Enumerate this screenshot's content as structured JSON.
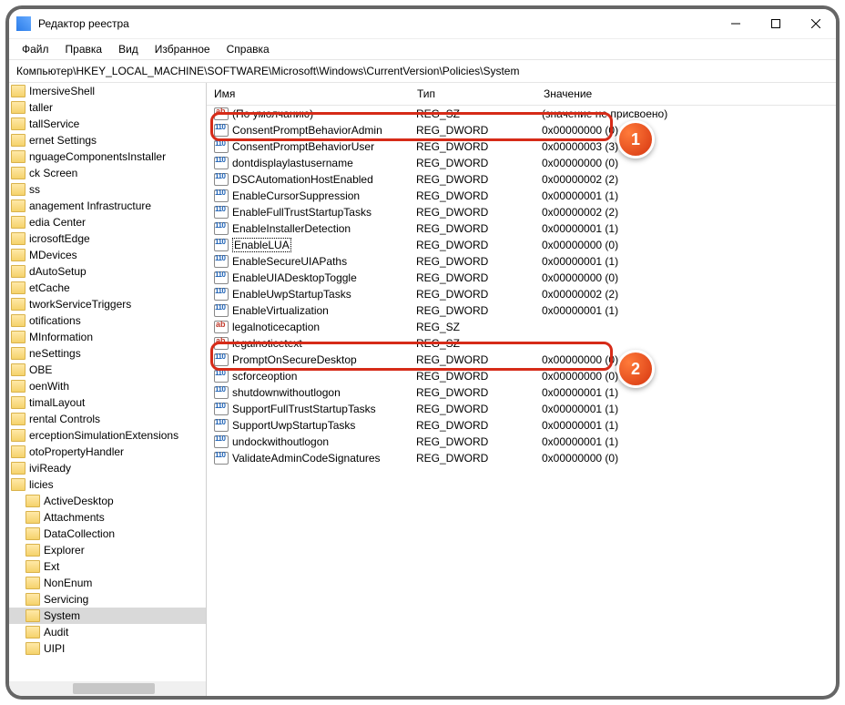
{
  "titlebar": {
    "title": "Редактор реестра"
  },
  "menu": {
    "file": "Файл",
    "edit": "Правка",
    "view": "Вид",
    "favorites": "Избранное",
    "help": "Справка"
  },
  "address": "Компьютер\\HKEY_LOCAL_MACHINE\\SOFTWARE\\Microsoft\\Windows\\CurrentVersion\\Policies\\System",
  "tree": [
    {
      "label": "ImersiveShell"
    },
    {
      "label": "taller"
    },
    {
      "label": "tallService"
    },
    {
      "label": "ernet Settings"
    },
    {
      "label": "nguageComponentsInstaller"
    },
    {
      "label": "ck Screen"
    },
    {
      "label": "ss"
    },
    {
      "label": "anagement Infrastructure"
    },
    {
      "label": "edia Center"
    },
    {
      "label": "icrosoftEdge"
    },
    {
      "label": "MDevices"
    },
    {
      "label": "dAutoSetup"
    },
    {
      "label": "etCache"
    },
    {
      "label": "tworkServiceTriggers"
    },
    {
      "label": "otifications"
    },
    {
      "label": "MInformation"
    },
    {
      "label": "neSettings"
    },
    {
      "label": "OBE"
    },
    {
      "label": "oenWith"
    },
    {
      "label": "timalLayout"
    },
    {
      "label": "rental Controls"
    },
    {
      "label": "erceptionSimulationExtensions"
    },
    {
      "label": "otoPropertyHandler"
    },
    {
      "label": "iviReady"
    },
    {
      "label": "licies"
    },
    {
      "label": "ActiveDesktop",
      "indent": 1
    },
    {
      "label": "Attachments",
      "indent": 1
    },
    {
      "label": "DataCollection",
      "indent": 1
    },
    {
      "label": "Explorer",
      "indent": 1
    },
    {
      "label": "Ext",
      "indent": 1
    },
    {
      "label": "NonEnum",
      "indent": 1
    },
    {
      "label": "Servicing",
      "indent": 1
    },
    {
      "label": "System",
      "indent": 1,
      "selected": true
    },
    {
      "label": "Audit",
      "indent": 1
    },
    {
      "label": "UIPI",
      "indent": 1
    }
  ],
  "list_header": {
    "name": "Имя",
    "type": "Тип",
    "value": "Значение"
  },
  "rows": [
    {
      "icon": "sz",
      "name": "(По умолчанию)",
      "type": "REG_SZ",
      "value": "(значение не присвоено)"
    },
    {
      "icon": "dw",
      "name": "ConsentPromptBehaviorAdmin",
      "type": "REG_DWORD",
      "value": "0x00000000 (0)"
    },
    {
      "icon": "dw",
      "name": "ConsentPromptBehaviorUser",
      "type": "REG_DWORD",
      "value": "0x00000003 (3)"
    },
    {
      "icon": "dw",
      "name": "dontdisplaylastusername",
      "type": "REG_DWORD",
      "value": "0x00000000 (0)"
    },
    {
      "icon": "dw",
      "name": "DSCAutomationHostEnabled",
      "type": "REG_DWORD",
      "value": "0x00000002 (2)"
    },
    {
      "icon": "dw",
      "name": "EnableCursorSuppression",
      "type": "REG_DWORD",
      "value": "0x00000001 (1)"
    },
    {
      "icon": "dw",
      "name": "EnableFullTrustStartupTasks",
      "type": "REG_DWORD",
      "value": "0x00000002 (2)"
    },
    {
      "icon": "dw",
      "name": "EnableInstallerDetection",
      "type": "REG_DWORD",
      "value": "0x00000001 (1)"
    },
    {
      "icon": "dw",
      "name": "EnableLUA",
      "type": "REG_DWORD",
      "value": "0x00000000 (0)",
      "selected": true
    },
    {
      "icon": "dw",
      "name": "EnableSecureUIAPaths",
      "type": "REG_DWORD",
      "value": "0x00000001 (1)"
    },
    {
      "icon": "dw",
      "name": "EnableUIADesktopToggle",
      "type": "REG_DWORD",
      "value": "0x00000000 (0)"
    },
    {
      "icon": "dw",
      "name": "EnableUwpStartupTasks",
      "type": "REG_DWORD",
      "value": "0x00000002 (2)"
    },
    {
      "icon": "dw",
      "name": "EnableVirtualization",
      "type": "REG_DWORD",
      "value": "0x00000001 (1)"
    },
    {
      "icon": "sz",
      "name": "legalnoticecaption",
      "type": "REG_SZ",
      "value": ""
    },
    {
      "icon": "sz",
      "name": "legalnoticetext",
      "type": "REG_SZ",
      "value": ""
    },
    {
      "icon": "dw",
      "name": "PromptOnSecureDesktop",
      "type": "REG_DWORD",
      "value": "0x00000000 (0)"
    },
    {
      "icon": "dw",
      "name": "scforceoption",
      "type": "REG_DWORD",
      "value": "0x00000000 (0)"
    },
    {
      "icon": "dw",
      "name": "shutdownwithoutlogon",
      "type": "REG_DWORD",
      "value": "0x00000001 (1)"
    },
    {
      "icon": "dw",
      "name": "SupportFullTrustStartupTasks",
      "type": "REG_DWORD",
      "value": "0x00000001 (1)"
    },
    {
      "icon": "dw",
      "name": "SupportUwpStartupTasks",
      "type": "REG_DWORD",
      "value": "0x00000001 (1)"
    },
    {
      "icon": "dw",
      "name": "undockwithoutlogon",
      "type": "REG_DWORD",
      "value": "0x00000001 (1)"
    },
    {
      "icon": "dw",
      "name": "ValidateAdminCodeSignatures",
      "type": "REG_DWORD",
      "value": "0x00000000 (0)"
    }
  ],
  "badges": {
    "one": "1",
    "two": "2"
  }
}
